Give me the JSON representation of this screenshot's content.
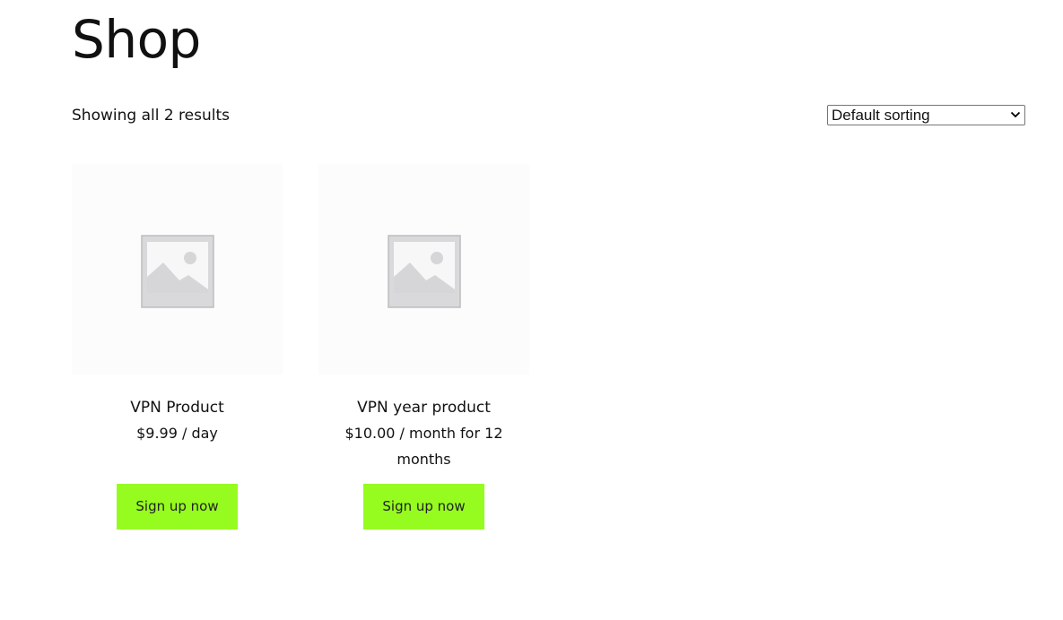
{
  "page": {
    "title": "Shop"
  },
  "toolbar": {
    "result_count": "Showing all 2 results",
    "sorting": {
      "selected": "Default sorting"
    }
  },
  "products": [
    {
      "title": "VPN Product",
      "price_line1": "$9.99 / day",
      "price_line2": "",
      "image_icon": "placeholder-image-icon",
      "button_label": "Sign up now"
    },
    {
      "title": "VPN year product",
      "price_line1": "$10.00 / month for 12",
      "price_line2": "months",
      "image_icon": "placeholder-image-icon",
      "button_label": "Sign up now"
    }
  ],
  "colors": {
    "button_bg": "#96fc1f",
    "thumb_bg": "#fcfcfc",
    "placeholder_grey": "#d8d8d8"
  }
}
